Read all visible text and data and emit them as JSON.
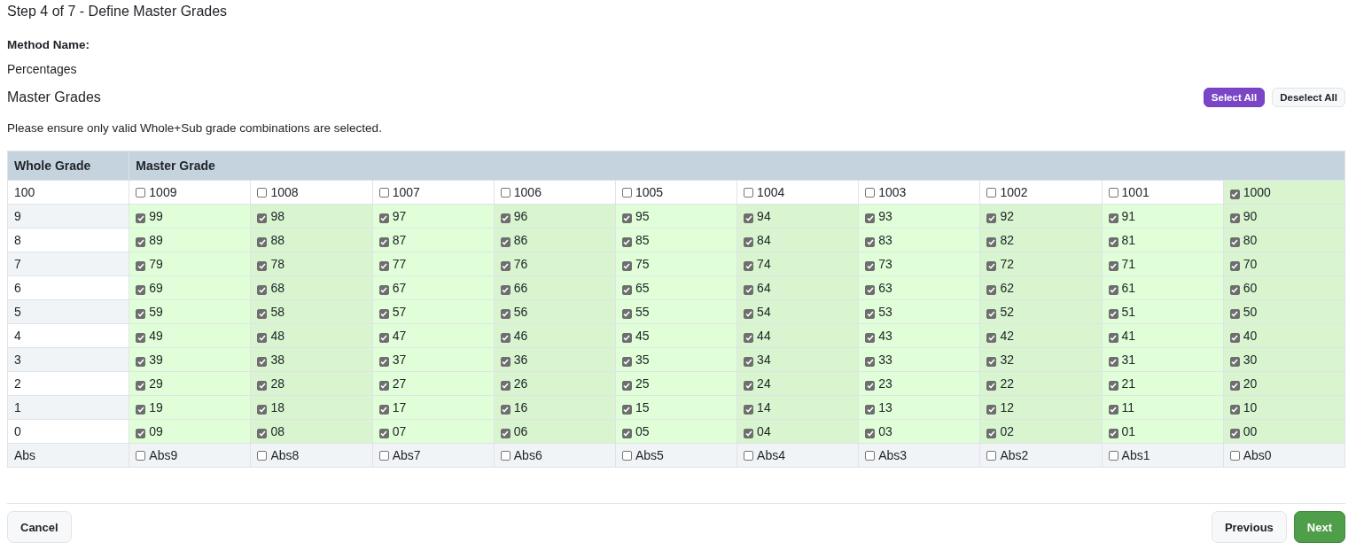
{
  "step_title": "Step 4 of 7 - Define Master Grades",
  "method_name_label": "Method Name:",
  "method_name_value": "Percentages",
  "section_title": "Master Grades",
  "actions": [
    {
      "label": "Select All",
      "kind": "primary"
    },
    {
      "label": "Deselect All",
      "kind": "secondary"
    }
  ],
  "notice": "Please ensure only valid Whole+Sub grade combinations are selected.",
  "table": {
    "columns": [
      {
        "label": "Whole Grade"
      },
      {
        "label": "Master Grade",
        "colspan": 10
      }
    ],
    "rows": [
      {
        "cells": [
          {
            "kind": "whole",
            "label": "100"
          },
          {
            "kind": "option",
            "label": "1009",
            "checked": false
          },
          {
            "kind": "option",
            "label": "1008",
            "checked": false
          },
          {
            "kind": "option",
            "label": "1007",
            "checked": false
          },
          {
            "kind": "option",
            "label": "1006",
            "checked": false
          },
          {
            "kind": "option",
            "label": "1005",
            "checked": false
          },
          {
            "kind": "option",
            "label": "1004",
            "checked": false
          },
          {
            "kind": "option",
            "label": "1003",
            "checked": false
          },
          {
            "kind": "option",
            "label": "1002",
            "checked": false
          },
          {
            "kind": "option",
            "label": "1001",
            "checked": false
          },
          {
            "kind": "option",
            "label": "1000",
            "checked": true
          }
        ]
      },
      {
        "cells": [
          {
            "kind": "whole",
            "label": "9"
          },
          {
            "kind": "option",
            "label": "99",
            "checked": true
          },
          {
            "kind": "option",
            "label": "98",
            "checked": true
          },
          {
            "kind": "option",
            "label": "97",
            "checked": true
          },
          {
            "kind": "option",
            "label": "96",
            "checked": true
          },
          {
            "kind": "option",
            "label": "95",
            "checked": true
          },
          {
            "kind": "option",
            "label": "94",
            "checked": true
          },
          {
            "kind": "option",
            "label": "93",
            "checked": true
          },
          {
            "kind": "option",
            "label": "92",
            "checked": true
          },
          {
            "kind": "option",
            "label": "91",
            "checked": true
          },
          {
            "kind": "option",
            "label": "90",
            "checked": true
          }
        ]
      },
      {
        "cells": [
          {
            "kind": "whole",
            "label": "8"
          },
          {
            "kind": "option",
            "label": "89",
            "checked": true
          },
          {
            "kind": "option",
            "label": "88",
            "checked": true
          },
          {
            "kind": "option",
            "label": "87",
            "checked": true
          },
          {
            "kind": "option",
            "label": "86",
            "checked": true
          },
          {
            "kind": "option",
            "label": "85",
            "checked": true
          },
          {
            "kind": "option",
            "label": "84",
            "checked": true
          },
          {
            "kind": "option",
            "label": "83",
            "checked": true
          },
          {
            "kind": "option",
            "label": "82",
            "checked": true
          },
          {
            "kind": "option",
            "label": "81",
            "checked": true
          },
          {
            "kind": "option",
            "label": "80",
            "checked": true
          }
        ]
      },
      {
        "cells": [
          {
            "kind": "whole",
            "label": "7"
          },
          {
            "kind": "option",
            "label": "79",
            "checked": true
          },
          {
            "kind": "option",
            "label": "78",
            "checked": true
          },
          {
            "kind": "option",
            "label": "77",
            "checked": true
          },
          {
            "kind": "option",
            "label": "76",
            "checked": true
          },
          {
            "kind": "option",
            "label": "75",
            "checked": true
          },
          {
            "kind": "option",
            "label": "74",
            "checked": true
          },
          {
            "kind": "option",
            "label": "73",
            "checked": true
          },
          {
            "kind": "option",
            "label": "72",
            "checked": true
          },
          {
            "kind": "option",
            "label": "71",
            "checked": true
          },
          {
            "kind": "option",
            "label": "70",
            "checked": true
          }
        ]
      },
      {
        "cells": [
          {
            "kind": "whole",
            "label": "6"
          },
          {
            "kind": "option",
            "label": "69",
            "checked": true
          },
          {
            "kind": "option",
            "label": "68",
            "checked": true
          },
          {
            "kind": "option",
            "label": "67",
            "checked": true
          },
          {
            "kind": "option",
            "label": "66",
            "checked": true
          },
          {
            "kind": "option",
            "label": "65",
            "checked": true
          },
          {
            "kind": "option",
            "label": "64",
            "checked": true
          },
          {
            "kind": "option",
            "label": "63",
            "checked": true
          },
          {
            "kind": "option",
            "label": "62",
            "checked": true
          },
          {
            "kind": "option",
            "label": "61",
            "checked": true
          },
          {
            "kind": "option",
            "label": "60",
            "checked": true
          }
        ]
      },
      {
        "cells": [
          {
            "kind": "whole",
            "label": "5"
          },
          {
            "kind": "option",
            "label": "59",
            "checked": true
          },
          {
            "kind": "option",
            "label": "58",
            "checked": true
          },
          {
            "kind": "option",
            "label": "57",
            "checked": true
          },
          {
            "kind": "option",
            "label": "56",
            "checked": true
          },
          {
            "kind": "option",
            "label": "55",
            "checked": true
          },
          {
            "kind": "option",
            "label": "54",
            "checked": true
          },
          {
            "kind": "option",
            "label": "53",
            "checked": true
          },
          {
            "kind": "option",
            "label": "52",
            "checked": true
          },
          {
            "kind": "option",
            "label": "51",
            "checked": true
          },
          {
            "kind": "option",
            "label": "50",
            "checked": true
          }
        ]
      },
      {
        "cells": [
          {
            "kind": "whole",
            "label": "4"
          },
          {
            "kind": "option",
            "label": "49",
            "checked": true
          },
          {
            "kind": "option",
            "label": "48",
            "checked": true
          },
          {
            "kind": "option",
            "label": "47",
            "checked": true
          },
          {
            "kind": "option",
            "label": "46",
            "checked": true
          },
          {
            "kind": "option",
            "label": "45",
            "checked": true
          },
          {
            "kind": "option",
            "label": "44",
            "checked": true
          },
          {
            "kind": "option",
            "label": "43",
            "checked": true
          },
          {
            "kind": "option",
            "label": "42",
            "checked": true
          },
          {
            "kind": "option",
            "label": "41",
            "checked": true
          },
          {
            "kind": "option",
            "label": "40",
            "checked": true
          }
        ]
      },
      {
        "cells": [
          {
            "kind": "whole",
            "label": "3"
          },
          {
            "kind": "option",
            "label": "39",
            "checked": true
          },
          {
            "kind": "option",
            "label": "38",
            "checked": true
          },
          {
            "kind": "option",
            "label": "37",
            "checked": true
          },
          {
            "kind": "option",
            "label": "36",
            "checked": true
          },
          {
            "kind": "option",
            "label": "35",
            "checked": true
          },
          {
            "kind": "option",
            "label": "34",
            "checked": true
          },
          {
            "kind": "option",
            "label": "33",
            "checked": true
          },
          {
            "kind": "option",
            "label": "32",
            "checked": true
          },
          {
            "kind": "option",
            "label": "31",
            "checked": true
          },
          {
            "kind": "option",
            "label": "30",
            "checked": true
          }
        ]
      },
      {
        "cells": [
          {
            "kind": "whole",
            "label": "2"
          },
          {
            "kind": "option",
            "label": "29",
            "checked": true
          },
          {
            "kind": "option",
            "label": "28",
            "checked": true
          },
          {
            "kind": "option",
            "label": "27",
            "checked": true
          },
          {
            "kind": "option",
            "label": "26",
            "checked": true
          },
          {
            "kind": "option",
            "label": "25",
            "checked": true
          },
          {
            "kind": "option",
            "label": "24",
            "checked": true
          },
          {
            "kind": "option",
            "label": "23",
            "checked": true
          },
          {
            "kind": "option",
            "label": "22",
            "checked": true
          },
          {
            "kind": "option",
            "label": "21",
            "checked": true
          },
          {
            "kind": "option",
            "label": "20",
            "checked": true
          }
        ]
      },
      {
        "cells": [
          {
            "kind": "whole",
            "label": "1"
          },
          {
            "kind": "option",
            "label": "19",
            "checked": true
          },
          {
            "kind": "option",
            "label": "18",
            "checked": true
          },
          {
            "kind": "option",
            "label": "17",
            "checked": true
          },
          {
            "kind": "option",
            "label": "16",
            "checked": true
          },
          {
            "kind": "option",
            "label": "15",
            "checked": true
          },
          {
            "kind": "option",
            "label": "14",
            "checked": true
          },
          {
            "kind": "option",
            "label": "13",
            "checked": true
          },
          {
            "kind": "option",
            "label": "12",
            "checked": true
          },
          {
            "kind": "option",
            "label": "11",
            "checked": true
          },
          {
            "kind": "option",
            "label": "10",
            "checked": true
          }
        ]
      },
      {
        "cells": [
          {
            "kind": "whole",
            "label": "0"
          },
          {
            "kind": "option",
            "label": "09",
            "checked": true
          },
          {
            "kind": "option",
            "label": "08",
            "checked": true
          },
          {
            "kind": "option",
            "label": "07",
            "checked": true
          },
          {
            "kind": "option",
            "label": "06",
            "checked": true
          },
          {
            "kind": "option",
            "label": "05",
            "checked": true
          },
          {
            "kind": "option",
            "label": "04",
            "checked": true
          },
          {
            "kind": "option",
            "label": "03",
            "checked": true
          },
          {
            "kind": "option",
            "label": "02",
            "checked": true
          },
          {
            "kind": "option",
            "label": "01",
            "checked": true
          },
          {
            "kind": "option",
            "label": "00",
            "checked": true
          }
        ]
      },
      {
        "cells": [
          {
            "kind": "whole",
            "label": "Abs"
          },
          {
            "kind": "option",
            "label": "Abs9",
            "checked": false
          },
          {
            "kind": "option",
            "label": "Abs8",
            "checked": false
          },
          {
            "kind": "option",
            "label": "Abs7",
            "checked": false
          },
          {
            "kind": "option",
            "label": "Abs6",
            "checked": false
          },
          {
            "kind": "option",
            "label": "Abs5",
            "checked": false
          },
          {
            "kind": "option",
            "label": "Abs4",
            "checked": false
          },
          {
            "kind": "option",
            "label": "Abs3",
            "checked": false
          },
          {
            "kind": "option",
            "label": "Abs2",
            "checked": false
          },
          {
            "kind": "option",
            "label": "Abs1",
            "checked": false
          },
          {
            "kind": "option",
            "label": "Abs0",
            "checked": false
          }
        ]
      }
    ]
  },
  "footer": {
    "left": [
      {
        "label": "Cancel",
        "kind": "secondary"
      }
    ],
    "right": [
      {
        "label": "Previous",
        "kind": "secondary"
      },
      {
        "label": "Next",
        "kind": "success"
      }
    ]
  }
}
